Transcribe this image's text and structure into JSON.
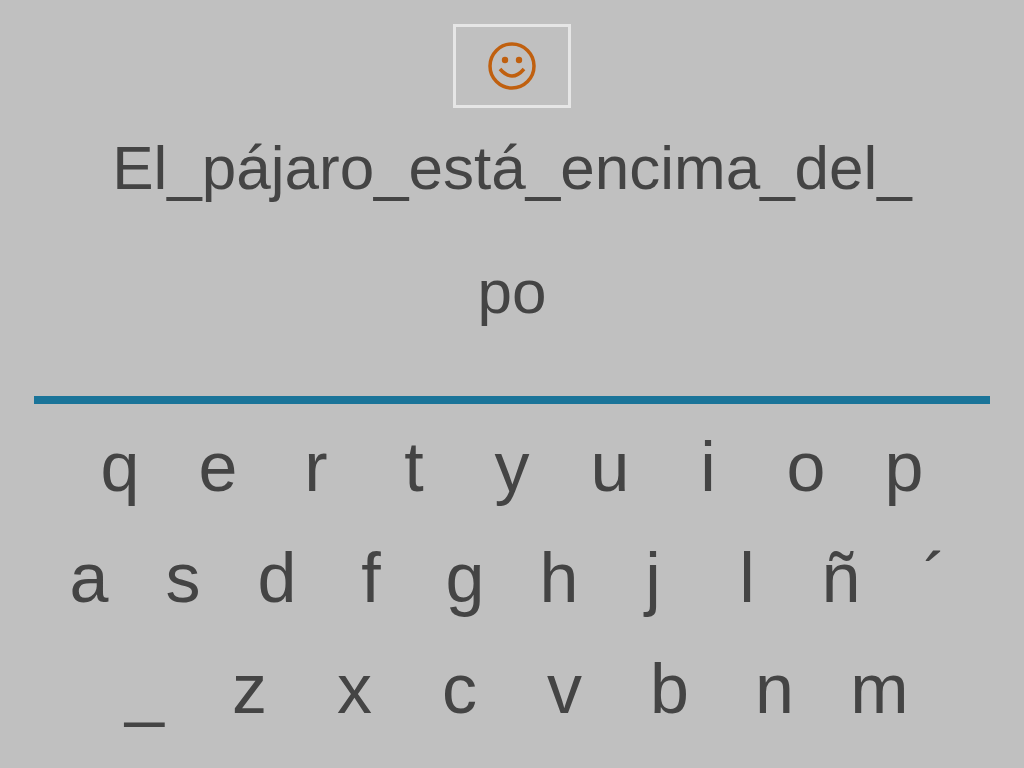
{
  "feedback": {
    "kind": "smile"
  },
  "sentence_lines": [
    "El_pájaro_está_encima_del_",
    "po"
  ],
  "keyboard": [
    [
      "q",
      "e",
      "r",
      "t",
      "y",
      "u",
      "i",
      "o",
      "p"
    ],
    [
      "a",
      "s",
      "d",
      "f",
      "g",
      "h",
      "j",
      "l",
      "ñ",
      "´"
    ],
    [
      "_",
      "z",
      "x",
      "c",
      "v",
      "b",
      "n",
      "m"
    ]
  ]
}
